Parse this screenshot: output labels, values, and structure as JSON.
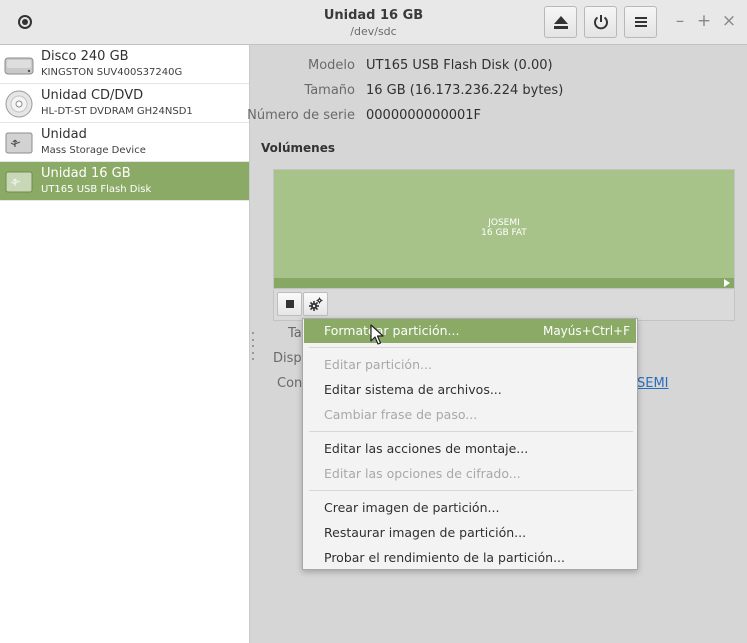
{
  "window": {
    "title": "Unidad 16 GB",
    "subtitle": "/dev/sdc",
    "buttons": {
      "eject": "eject-icon",
      "power": "power-icon",
      "menu": "menu-icon"
    },
    "controls": {
      "minimize": "–",
      "maximize": "+",
      "close": "×"
    }
  },
  "sidebar": {
    "items": [
      {
        "name": "Disco 240 GB",
        "sub": "KINGSTON SUV400S37240G",
        "icon": "hard-disk-icon",
        "selected": false
      },
      {
        "name": "Unidad CD/DVD",
        "sub": "HL-DT-ST DVDRAM GH24NSD1",
        "icon": "optical-disc-icon",
        "selected": false
      },
      {
        "name": "Unidad",
        "sub": "Mass Storage Device",
        "icon": "usb-drive-icon",
        "selected": false
      },
      {
        "name": "Unidad 16 GB",
        "sub": "UT165 USB Flash Disk",
        "icon": "usb-drive-icon",
        "selected": true
      }
    ]
  },
  "info": {
    "model_label": "Modelo",
    "model_value": "UT165 USB Flash Disk (0.00)",
    "size_label": "Tamaño",
    "size_value": "16 GB (16.173.236.224 bytes)",
    "serial_label": "Número de serie",
    "serial_value": "0000000000001F"
  },
  "volumes": {
    "heading": "Volúmenes",
    "partition_name": "JOSEMI",
    "partition_desc": "16 GB FAT",
    "selected_color": "#a7c38a"
  },
  "details_partial": {
    "size_label": "Ta",
    "device_label": "Dispo",
    "contents_label": "Cont",
    "contents_link": "SEMI"
  },
  "context_menu": {
    "items": [
      {
        "label": "Formatear partición...",
        "accel": "Mayús+Ctrl+F",
        "enabled": true,
        "highlighted": true
      },
      {
        "label": "Editar partición...",
        "enabled": false
      },
      {
        "label": "Editar sistema de archivos...",
        "enabled": true
      },
      {
        "label": "Cambiar frase de paso...",
        "enabled": false
      },
      {
        "label": "Editar las acciones de montaje...",
        "enabled": true
      },
      {
        "label": "Editar las opciones de cifrado...",
        "enabled": false
      },
      {
        "label": "Crear imagen de partición...",
        "enabled": true
      },
      {
        "label": "Restaurar imagen de partición...",
        "enabled": true
      },
      {
        "label": "Probar el rendimiento de la partición...",
        "enabled": true
      }
    ]
  },
  "colors": {
    "accent": "#8aaa66",
    "link": "#2a6ebb"
  }
}
